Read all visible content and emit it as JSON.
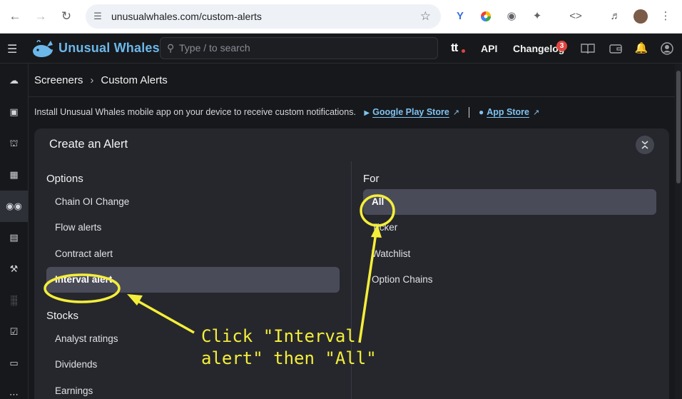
{
  "browser": {
    "url": "unusualwhales.com/custom-alerts"
  },
  "app": {
    "brand": "Unusual Whales",
    "search_placeholder": "Type / to search",
    "tt_label": "tt",
    "api_label": "API",
    "changelog_label": "Changelog",
    "changelog_badge": "3"
  },
  "breadcrumb": {
    "parent": "Screeners",
    "current": "Custom Alerts"
  },
  "install_banner": {
    "text": "Install Unusual Whales mobile app on your device to receive custom notifications.",
    "google_play": "Google Play Store",
    "app_store": "App Store"
  },
  "modal": {
    "title": "Create an Alert",
    "left": {
      "options_heading": "Options",
      "options": [
        "Chain OI Change",
        "Flow alerts",
        "Contract alert",
        "Interval alert"
      ],
      "stocks_heading": "Stocks",
      "stocks": [
        "Analyst ratings",
        "Dividends",
        "Earnings"
      ]
    },
    "right": {
      "heading": "For",
      "items": [
        "All",
        "Ticker",
        "Watchlist",
        "Option Chains"
      ]
    }
  },
  "annotation": {
    "line1": "Click \"Interval",
    "line2": "alert\" then \"All\"",
    "color": "#f4ee3a"
  }
}
